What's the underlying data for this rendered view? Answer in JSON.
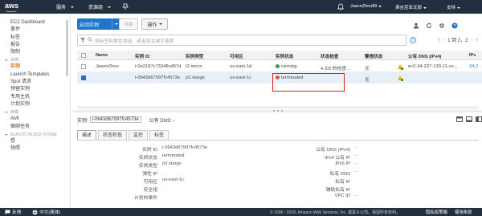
{
  "topbar": {
    "logo": "aws",
    "services": "服务",
    "resource_groups": "资源组",
    "user": "JasonZhou89",
    "region": "弗吉尼亚北部",
    "support": "支持"
  },
  "sidebar": {
    "items_top": [
      "EC2 Dashboard",
      "事件",
      "标签",
      "报告",
      "限制"
    ],
    "section_instances": "实例",
    "items_instances": [
      "实例",
      "Launch Templates",
      "Spot 请求",
      "预留实例",
      "专用主机",
      "计划实例"
    ],
    "section_images": "映像",
    "items_images": [
      "AMI",
      "捆绑任务"
    ],
    "section_ebs": "ELASTIC BLOCK STORE",
    "items_ebs": [
      "卷",
      "快照"
    ]
  },
  "toolbar": {
    "launch": "启动实例",
    "connect": "连接",
    "actions": "操作"
  },
  "search": {
    "placeholder": "按标签和属性筛选，或者按关键字搜索"
  },
  "pager": {
    "text": "1 到 2，2"
  },
  "table": {
    "headers": [
      "Name",
      "实例 ID",
      "实例类型",
      "可用区",
      "实例状态",
      "状态检查",
      "警报状态",
      "公有 DNS (IPv4)",
      "IPv"
    ],
    "rows": [
      {
        "name": "JasonZhou",
        "id": "i-0e2187c73348cd57d",
        "type": "t2.micro",
        "az": "us-east-1d",
        "state": "running",
        "check": "2/2 的检查...",
        "alarm": "无",
        "dns": "ec2-34-237-133-11.co...",
        "ipv": "34.2"
      },
      {
        "name": "",
        "id": "i-0643d67997fc4573e",
        "type": "p2.xlarge",
        "az": "us-east-1c",
        "state": "terminated",
        "check": "",
        "alarm": "无",
        "dns": "",
        "ipv": ""
      }
    ]
  },
  "detail": {
    "label_instance": "实例:",
    "instance_id": "i-0643d67997fc4573e",
    "label_dns": "公有 DNS: -",
    "tabs": [
      "描述",
      "状态检查",
      "监控",
      "标签"
    ],
    "left_keys": [
      "实例 ID",
      "实例状态",
      "实例类型",
      "弹性 IP",
      "可用区",
      "安全组",
      "计划的事件"
    ],
    "left_vals": [
      "i-0643d67997fc4573e",
      "terminated",
      "p2.xlarge",
      "",
      "us-east-1c",
      "",
      ""
    ],
    "right_keys": [
      "公有 DNS (IPv4)",
      "IPv4 公有 IP",
      "IPv6 IP",
      "私有 DNS",
      "私有 IP",
      "辅助私有 IP",
      "VPC ID"
    ],
    "right_vals": [
      "-",
      "-",
      "-",
      "-",
      "",
      "",
      "-"
    ]
  },
  "footer": {
    "feedback": "反馈",
    "language": "中文(简体)",
    "copyright": "© 2008 - 2018, Amazon Web Services, Inc. 或其子公司。保留所有权利。",
    "privacy": "隐私权策略",
    "terms": "使用条款"
  },
  "colors": {
    "topbar": "#232f3e",
    "accent": "#e47911",
    "primary": "#2176ca",
    "running": "#3c9a3c",
    "terminated": "#d9534f"
  }
}
